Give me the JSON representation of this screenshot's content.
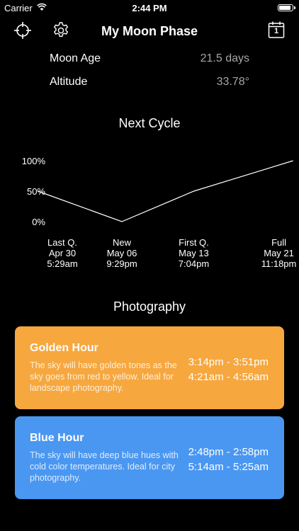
{
  "status": {
    "carrier": "Carrier",
    "time": "2:44 PM",
    "battery_level": 0.95
  },
  "nav": {
    "title": "My Moon Phase",
    "calendar_day": "1"
  },
  "info": [
    {
      "label": "Moon Age",
      "value": "21.5 days"
    },
    {
      "label": "Altitude",
      "value": "33.78°"
    }
  ],
  "next_cycle": {
    "title": "Next Cycle"
  },
  "chart_data": {
    "type": "line",
    "y_ticks": [
      "100%",
      "50%",
      "0%"
    ],
    "ylim": [
      0,
      100
    ],
    "x": [
      {
        "phase": "Last Q.",
        "date": "Apr 30",
        "time": "5:29am",
        "day_offset": 0
      },
      {
        "phase": "New",
        "date": "May 06",
        "time": "9:29pm",
        "day_offset": 6.67
      },
      {
        "phase": "First Q.",
        "date": "May 13",
        "time": "7:04pm",
        "day_offset": 13.57
      },
      {
        "phase": "Full",
        "date": "May 21",
        "time": "11:18pm",
        "day_offset": 21.74
      }
    ],
    "series": [
      {
        "points": [
          {
            "day_offset": -1.4,
            "value": 50
          },
          {
            "day_offset": 6.67,
            "value": 0
          },
          {
            "day_offset": 13.57,
            "value": 50
          },
          {
            "day_offset": 23.1,
            "value": 100
          }
        ]
      }
    ],
    "grid": false
  },
  "photography": {
    "title": "Photography",
    "cards": [
      {
        "title": "Golden Hour",
        "description": "The sky will have golden tones as the sky goes from red to yellow. Ideal for landscape photography.",
        "times": [
          "3:14pm - 3:51pm",
          "4:21am - 4:56am"
        ],
        "color": "#F6A73E"
      },
      {
        "title": "Blue Hour",
        "description": "The sky will have deep blue hues with cold color temperatures. Ideal for city photography.",
        "times": [
          "2:48pm - 2:58pm",
          "5:14am - 5:25am"
        ],
        "color": "#4A97F1"
      }
    ]
  }
}
